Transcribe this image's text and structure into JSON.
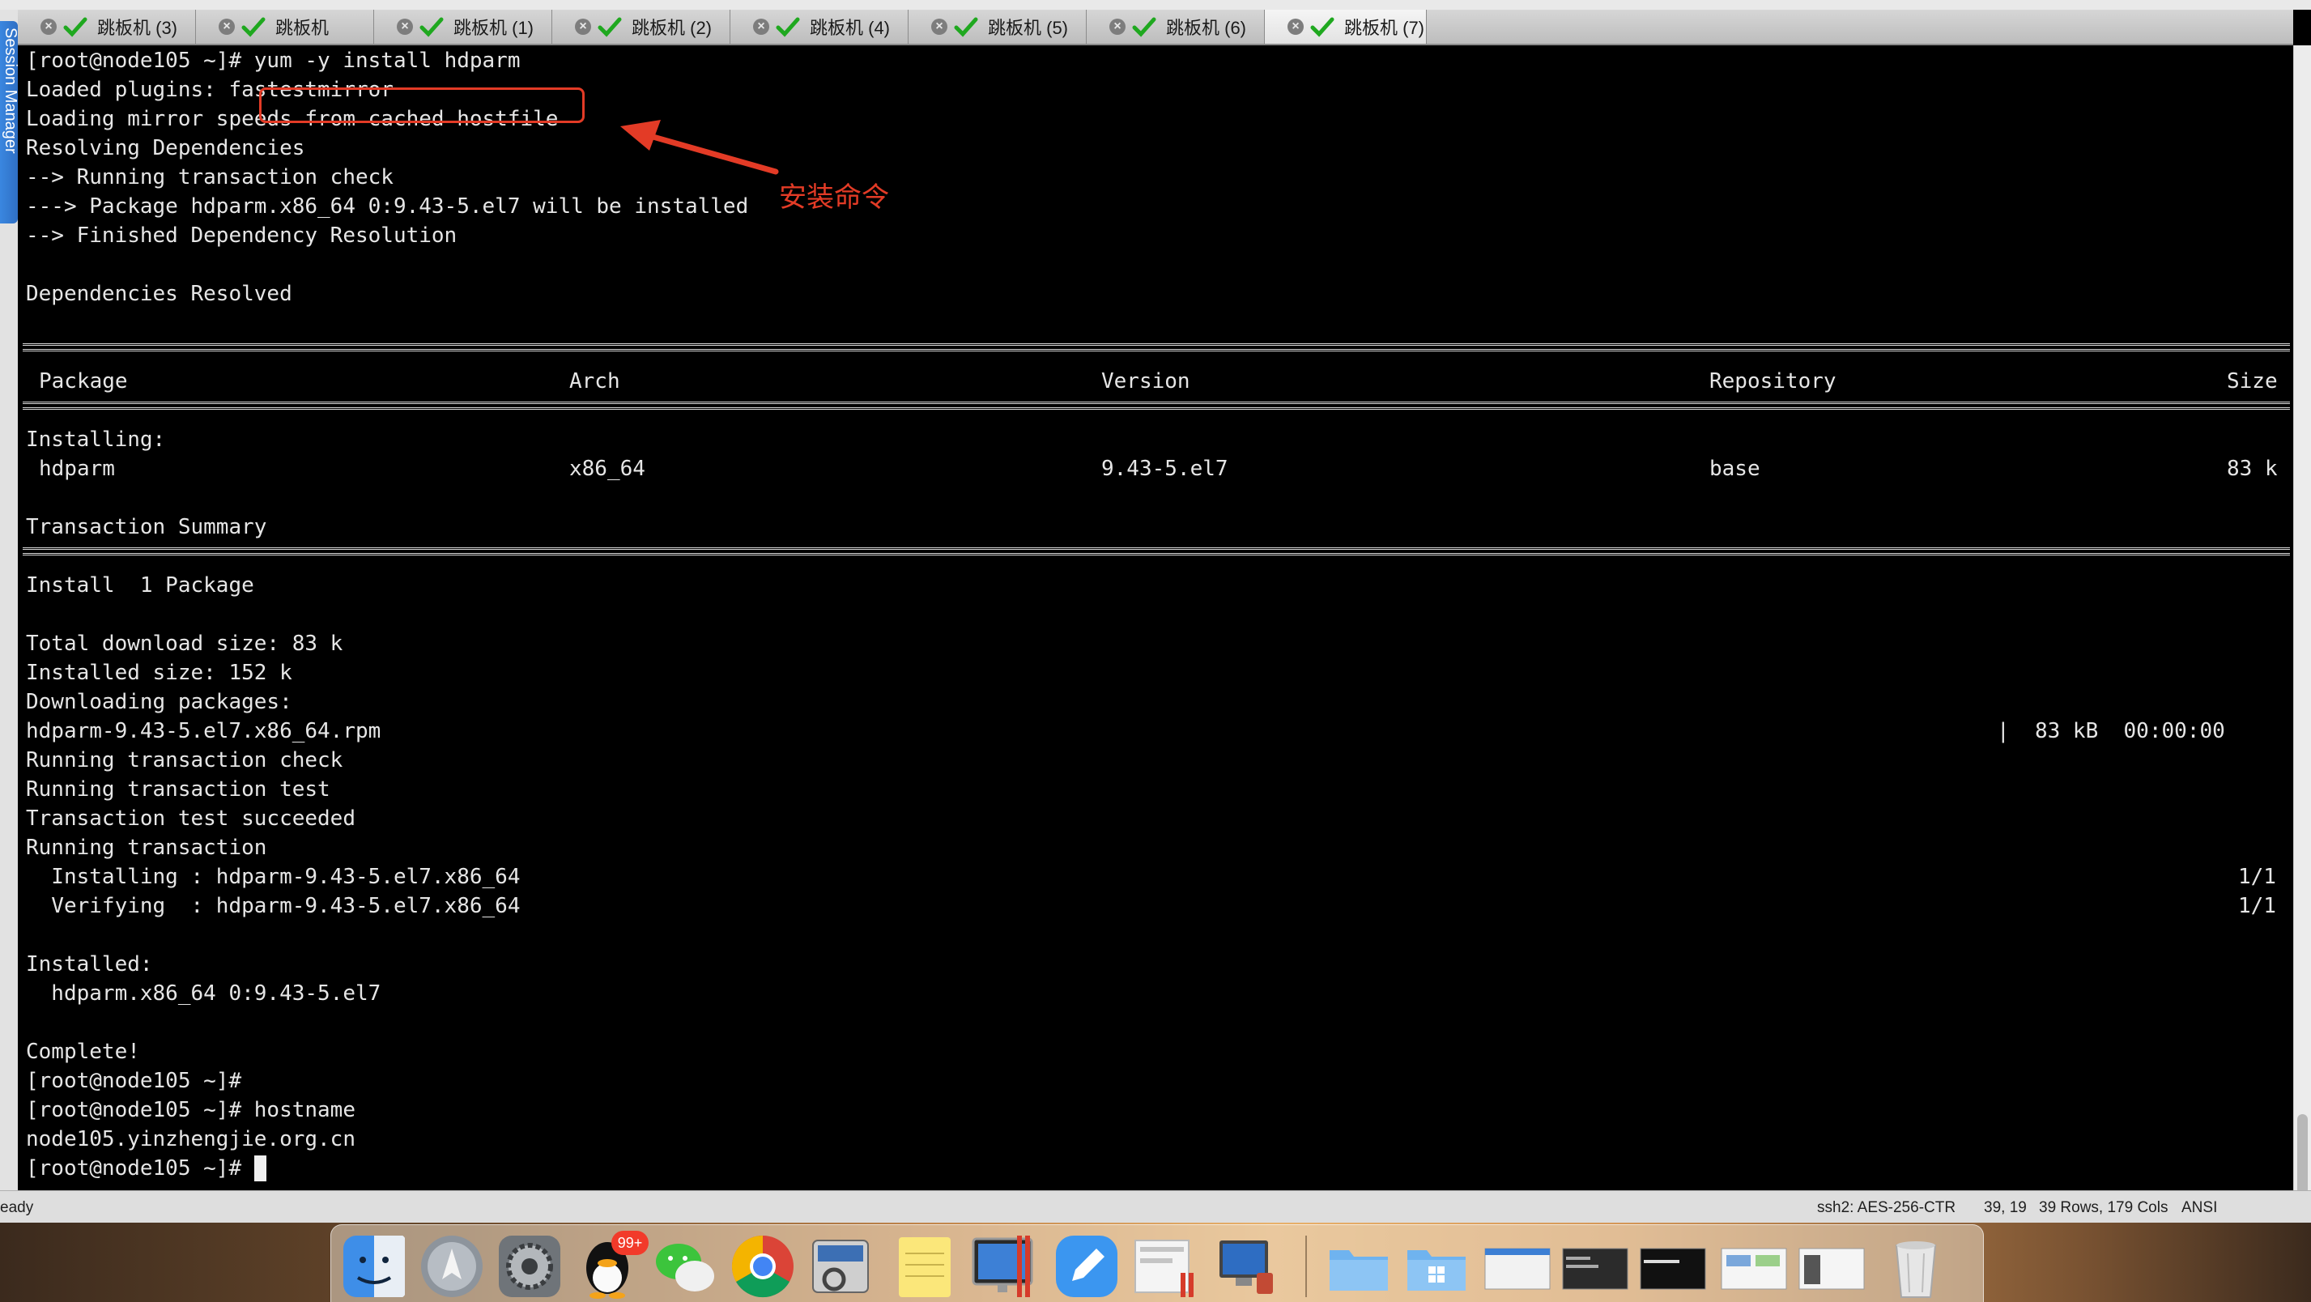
{
  "tabs": [
    {
      "label": "跳板机 (3)",
      "active": false
    },
    {
      "label": "跳板机",
      "active": false
    },
    {
      "label": "跳板机 (1)",
      "active": false
    },
    {
      "label": "跳板机 (2)",
      "active": false
    },
    {
      "label": "跳板机 (4)",
      "active": false
    },
    {
      "label": "跳板机 (5)",
      "active": false
    },
    {
      "label": "跳板机 (6)",
      "active": false
    },
    {
      "label": "跳板机 (7)",
      "active": true
    }
  ],
  "session_manager": {
    "label": "Session Manager"
  },
  "terminal": {
    "prompt": "[root@node105 ~]#",
    "command": "yum -y install hdparm",
    "lines": [
      "Loaded plugins: fastestmirror",
      "Loading mirror speeds from cached hostfile",
      "Resolving Dependencies",
      "--> Running transaction check",
      "---> Package hdparm.x86_64 0:9.43-5.el7 will be installed",
      "--> Finished Dependency Resolution",
      "",
      "Dependencies Resolved"
    ],
    "table": {
      "headers": [
        "Package",
        "Arch",
        "Version",
        "Repository",
        "Size"
      ],
      "section": "Installing:",
      "row": [
        "hdparm",
        "x86_64",
        "9.43-5.el7",
        "base",
        "83 k"
      ]
    },
    "summary_title": "Transaction Summary",
    "install_count": "Install  1 Package",
    "lines2": [
      "Total download size: 83 k",
      "Installed size: 152 k",
      "Downloading packages:"
    ],
    "download": {
      "file": "hdparm-9.43-5.el7.x86_64.rpm",
      "progress": "|  83 kB  00:00:00"
    },
    "lines3": [
      "Running transaction check",
      "Running transaction test",
      "Transaction test succeeded",
      "Running transaction"
    ],
    "steps": [
      {
        "text": "  Installing : hdparm-9.43-5.el7.x86_64",
        "count": "1/1"
      },
      {
        "text": "  Verifying  : hdparm-9.43-5.el7.x86_64",
        "count": "1/1"
      }
    ],
    "installed_title": "Installed:",
    "installed_pkg": "  hdparm.x86_64 0:9.43-5.el7",
    "complete": "Complete!",
    "cmd2": "hostname",
    "hostname_output": "node105.yinzhengjie.org.cn"
  },
  "annotation": {
    "text": "安装命令",
    "color": "#e33b26"
  },
  "status": {
    "left": "eady",
    "cipher": "ssh2: AES-256-CTR",
    "position": "39, 19",
    "dimensions": "39 Rows, 179 Cols",
    "mode": "ANSI"
  },
  "dock": {
    "badge": "99+",
    "apps": [
      "finder-icon",
      "launchpad-icon",
      "system-preferences-icon",
      "qq-icon",
      "wechat-icon",
      "chrome-icon",
      "keychain-icon",
      "notes-icon",
      "activity-monitor-icon",
      "pen-icon",
      "document-icon",
      "remote-desktop-icon",
      "folder-icon",
      "windows-folder-icon",
      "window-thumbnail-icon",
      "window-thumbnail-icon",
      "window-thumbnail-icon",
      "window-thumbnail-icon",
      "window-thumbnail-icon",
      "trash-icon"
    ]
  },
  "colors": {
    "terminal_bg": "#000000",
    "terminal_fg": "#e6e6e6",
    "accent_red": "#e33b26",
    "tab_check": "#1fa81f"
  }
}
